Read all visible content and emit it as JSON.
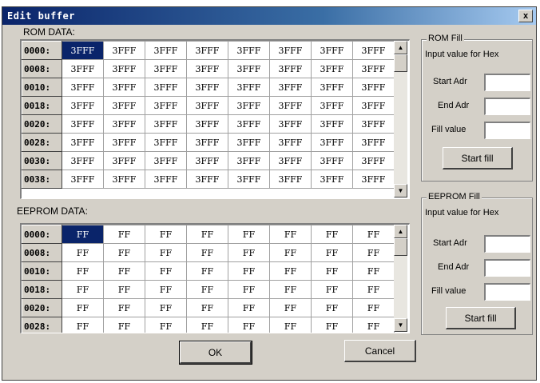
{
  "window": {
    "title": "Edit buffer",
    "close_label": "x"
  },
  "rom": {
    "label": "ROM DATA:",
    "rows": [
      {
        "addr": "0000:",
        "cells": [
          "3FFF",
          "3FFF",
          "3FFF",
          "3FFF",
          "3FFF",
          "3FFF",
          "3FFF",
          "3FFF"
        ]
      },
      {
        "addr": "0008:",
        "cells": [
          "3FFF",
          "3FFF",
          "3FFF",
          "3FFF",
          "3FFF",
          "3FFF",
          "3FFF",
          "3FFF"
        ]
      },
      {
        "addr": "0010:",
        "cells": [
          "3FFF",
          "3FFF",
          "3FFF",
          "3FFF",
          "3FFF",
          "3FFF",
          "3FFF",
          "3FFF"
        ]
      },
      {
        "addr": "0018:",
        "cells": [
          "3FFF",
          "3FFF",
          "3FFF",
          "3FFF",
          "3FFF",
          "3FFF",
          "3FFF",
          "3FFF"
        ]
      },
      {
        "addr": "0020:",
        "cells": [
          "3FFF",
          "3FFF",
          "3FFF",
          "3FFF",
          "3FFF",
          "3FFF",
          "3FFF",
          "3FFF"
        ]
      },
      {
        "addr": "0028:",
        "cells": [
          "3FFF",
          "3FFF",
          "3FFF",
          "3FFF",
          "3FFF",
          "3FFF",
          "3FFF",
          "3FFF"
        ]
      },
      {
        "addr": "0030:",
        "cells": [
          "3FFF",
          "3FFF",
          "3FFF",
          "3FFF",
          "3FFF",
          "3FFF",
          "3FFF",
          "3FFF"
        ]
      },
      {
        "addr": "0038:",
        "cells": [
          "3FFF",
          "3FFF",
          "3FFF",
          "3FFF",
          "3FFF",
          "3FFF",
          "3FFF",
          "3FFF"
        ]
      }
    ]
  },
  "eeprom": {
    "label": "EEPROM DATA:",
    "rows": [
      {
        "addr": "0000:",
        "cells": [
          "FF",
          "FF",
          "FF",
          "FF",
          "FF",
          "FF",
          "FF",
          "FF"
        ]
      },
      {
        "addr": "0008:",
        "cells": [
          "FF",
          "FF",
          "FF",
          "FF",
          "FF",
          "FF",
          "FF",
          "FF"
        ]
      },
      {
        "addr": "0010:",
        "cells": [
          "FF",
          "FF",
          "FF",
          "FF",
          "FF",
          "FF",
          "FF",
          "FF"
        ]
      },
      {
        "addr": "0018:",
        "cells": [
          "FF",
          "FF",
          "FF",
          "FF",
          "FF",
          "FF",
          "FF",
          "FF"
        ]
      },
      {
        "addr": "0020:",
        "cells": [
          "FF",
          "FF",
          "FF",
          "FF",
          "FF",
          "FF",
          "FF",
          "FF"
        ]
      },
      {
        "addr": "0028:",
        "cells": [
          "FF",
          "FF",
          "FF",
          "FF",
          "FF",
          "FF",
          "FF",
          "FF"
        ]
      }
    ]
  },
  "rom_fill": {
    "title": "ROM Fill",
    "hint": "Input value for Hex",
    "start_label": "Start Adr",
    "end_label": "End Adr",
    "fill_label": "Fill value",
    "start_value": "",
    "end_value": "",
    "fill_value": "",
    "button": "Start fill"
  },
  "eeprom_fill": {
    "title": "EEPROM Fill",
    "hint": "Input value for Hex",
    "start_label": "Start Adr",
    "end_label": "End Adr",
    "fill_label": "Fill value",
    "start_value": "",
    "end_value": "",
    "fill_value": "",
    "button": "Start fill"
  },
  "buttons": {
    "ok": "OK",
    "cancel": "Cancel"
  },
  "icons": {
    "scroll_up": "up-arrow-icon",
    "scroll_down": "down-arrow-icon"
  },
  "colors": {
    "titlebar": "#0a246a",
    "selection": "#0a246a",
    "face": "#d4d0c8"
  }
}
